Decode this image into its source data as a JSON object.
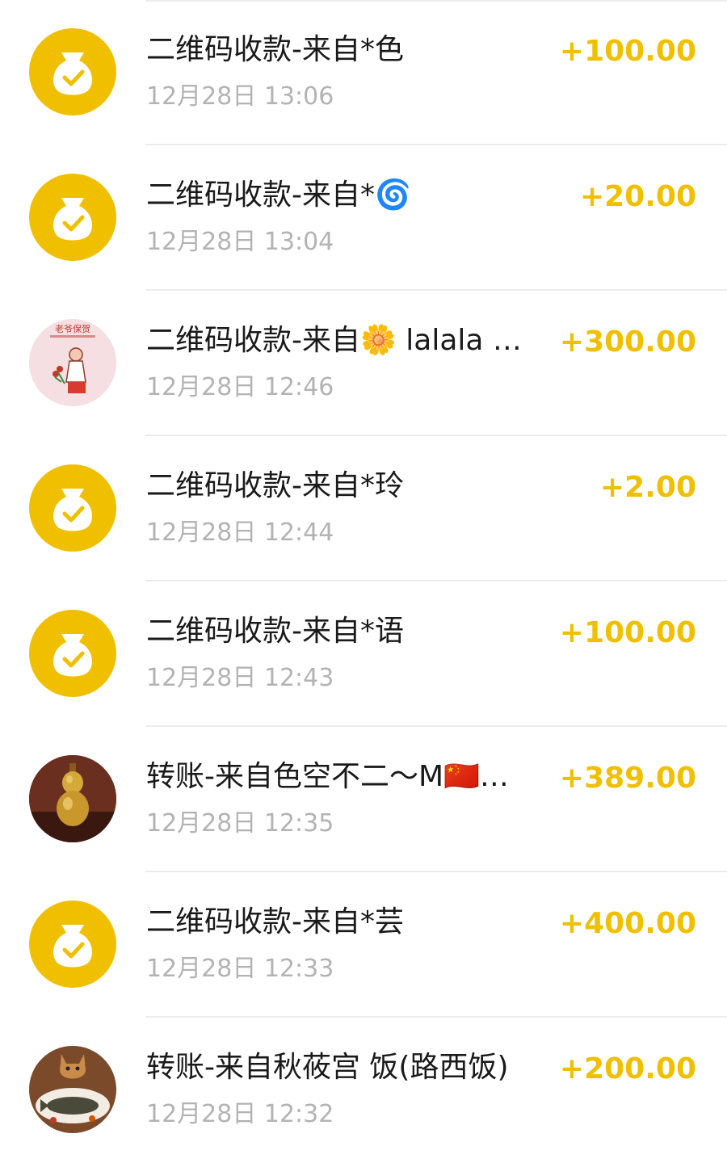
{
  "accent_color": "#F0C000",
  "transactions": [
    {
      "title": "二维码收款-来自*色",
      "time": "12月28日 13:06",
      "amount": "+100.00",
      "avatar": "money-bag-icon"
    },
    {
      "title": "二维码收款-来自*🌀",
      "time": "12月28日 13:04",
      "amount": "+20.00",
      "avatar": "money-bag-icon"
    },
    {
      "title": "二维码收款-来自🌼 lalala …",
      "time": "12月28日 12:46",
      "amount": "+300.00",
      "avatar": "user-photo",
      "avatar_text": "老爷保贺"
    },
    {
      "title": "二维码收款-来自*玲",
      "time": "12月28日 12:44",
      "amount": "+2.00",
      "avatar": "money-bag-icon"
    },
    {
      "title": "二维码收款-来自*语",
      "time": "12月28日 12:43",
      "amount": "+100.00",
      "avatar": "money-bag-icon"
    },
    {
      "title": "转账-来自色空不二～M🇨🇳…",
      "time": "12月28日 12:35",
      "amount": "+389.00",
      "avatar": "user-photo"
    },
    {
      "title": "二维码收款-来自*芸",
      "time": "12月28日 12:33",
      "amount": "+400.00",
      "avatar": "money-bag-icon"
    },
    {
      "title": "转账-来自秋莜宫 饭(路西饭)",
      "time": "12月28日 12:32",
      "amount": "+200.00",
      "avatar": "user-photo"
    }
  ]
}
